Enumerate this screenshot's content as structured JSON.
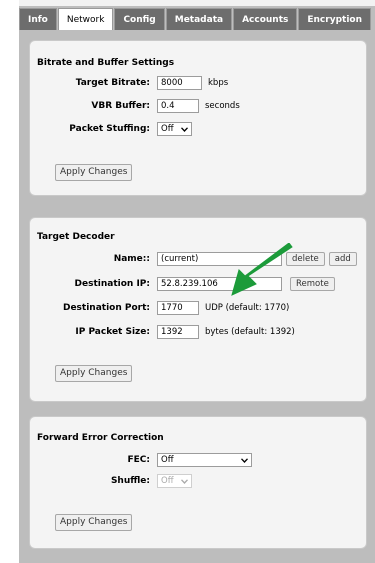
{
  "tabs": [
    {
      "label": "Info",
      "active": false
    },
    {
      "label": "Network",
      "active": true
    },
    {
      "label": "Config",
      "active": false
    },
    {
      "label": "Metadata",
      "active": false
    },
    {
      "label": "Accounts",
      "active": false
    },
    {
      "label": "Encryption",
      "active": false
    }
  ],
  "bitrate": {
    "title": "Bitrate and Buffer Settings",
    "target_bitrate_label": "Target Bitrate:",
    "target_bitrate_value": "8000",
    "target_bitrate_unit": "kbps",
    "vbr_buffer_label": "VBR Buffer:",
    "vbr_buffer_value": "0.4",
    "vbr_buffer_unit": "seconds",
    "packet_stuffing_label": "Packet Stuffing:",
    "packet_stuffing_value": "Off",
    "apply_label": "Apply Changes"
  },
  "decoder": {
    "title": "Target Decoder",
    "name_label": "Name::",
    "name_value": "(current)",
    "delete_label": "delete",
    "add_label": "add",
    "dest_ip_label": "Destination IP:",
    "dest_ip_value": "52.8.239.106",
    "remote_label": "Remote",
    "dest_port_label": "Destination Port:",
    "dest_port_value": "1770",
    "dest_port_note": "UDP (default: 1770)",
    "packet_size_label": "IP Packet Size:",
    "packet_size_value": "1392",
    "packet_size_note": "bytes (default: 1392)",
    "apply_label": "Apply Changes"
  },
  "fec": {
    "title": "Forward Error Correction",
    "fec_label": "FEC:",
    "fec_value": "Off",
    "shuffle_label": "Shuffle:",
    "shuffle_value": "Off",
    "apply_label": "Apply Changes"
  },
  "colors": {
    "tab_bg": "#6d6d6d",
    "panel_bg": "#f4f4f4",
    "frame_bg": "#bdbdbd",
    "arrow": "#1c9b3a"
  },
  "icons": {
    "dropdown": "chevron-down-icon",
    "annotation": "arrow-icon"
  }
}
